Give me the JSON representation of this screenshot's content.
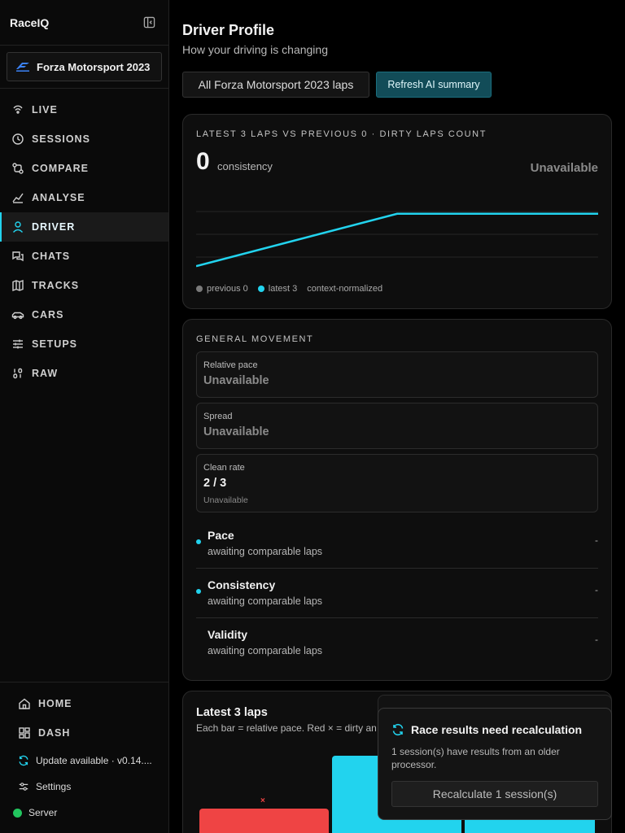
{
  "app": {
    "name": "RaceIQ"
  },
  "game_selector": {
    "label": "Forza Motorsport 2023"
  },
  "nav": [
    {
      "label": "LIVE",
      "icon": "signal-icon"
    },
    {
      "label": "SESSIONS",
      "icon": "history-icon"
    },
    {
      "label": "COMPARE",
      "icon": "compare-icon"
    },
    {
      "label": "ANALYSE",
      "icon": "analyse-icon"
    },
    {
      "label": "DRIVER",
      "icon": "user-icon",
      "active": true
    },
    {
      "label": "CHATS",
      "icon": "chat-icon"
    },
    {
      "label": "TRACKS",
      "icon": "map-icon"
    },
    {
      "label": "CARS",
      "icon": "car-icon"
    },
    {
      "label": "SETUPS",
      "icon": "sliders-icon"
    },
    {
      "label": "RAW",
      "icon": "binary-icon"
    }
  ],
  "sidebar_bottom": {
    "home": "HOME",
    "dash": "DASH",
    "update": "Update available · v0.14....",
    "settings": "Settings",
    "server": "Server",
    "server_status_color": "#22c55e"
  },
  "header": {
    "title": "Driver Profile",
    "subtitle": "How your driving is changing",
    "scope_button": "All Forza Motorsport 2023 laps",
    "refresh_button": "Refresh AI summary"
  },
  "consistency_card": {
    "label": "LATEST 3 LAPS VS PREVIOUS 0 · DIRTY LAPS COUNT",
    "value": "0",
    "unit": "consistency",
    "status": "Unavailable",
    "legend": {
      "previous": "previous 0",
      "latest": "latest 3",
      "note": "context-normalized"
    },
    "colors": {
      "previous": "#7a7a7a",
      "latest": "#22d3ee"
    }
  },
  "chart_data": {
    "type": "line",
    "x": [
      0,
      1,
      2
    ],
    "series": [
      {
        "name": "latest 3",
        "values": [
          0.15,
          0.85,
          0.85
        ]
      }
    ],
    "ylim": [
      0,
      1
    ],
    "grid": true
  },
  "movement_card": {
    "label": "GENERAL MOVEMENT",
    "stats": [
      {
        "label": "Relative pace",
        "value": "Unavailable",
        "note": ""
      },
      {
        "label": "Spread",
        "value": "Unavailable",
        "note": ""
      },
      {
        "label": "Clean rate",
        "value": "2 / 3",
        "note": "Unavailable"
      }
    ],
    "metrics": [
      {
        "title": "Pace",
        "subtitle": "awaiting comparable laps",
        "value": "-"
      },
      {
        "title": "Consistency",
        "subtitle": "awaiting comparable laps",
        "value": "-"
      },
      {
        "title": "Validity",
        "subtitle": "awaiting comparable laps",
        "value": "-"
      }
    ]
  },
  "laps_card": {
    "title": "Latest 3 laps",
    "subtitle": "Each bar = relative pace. Red × = dirty an",
    "dirty_mark": "×",
    "colors": {
      "clean": "#22d3ee",
      "dirty": "#ef4444"
    }
  },
  "toast": {
    "title": "Race results need recalculation",
    "body": "1 session(s) have results from an older processor.",
    "button": "Recalculate 1 session(s)"
  }
}
